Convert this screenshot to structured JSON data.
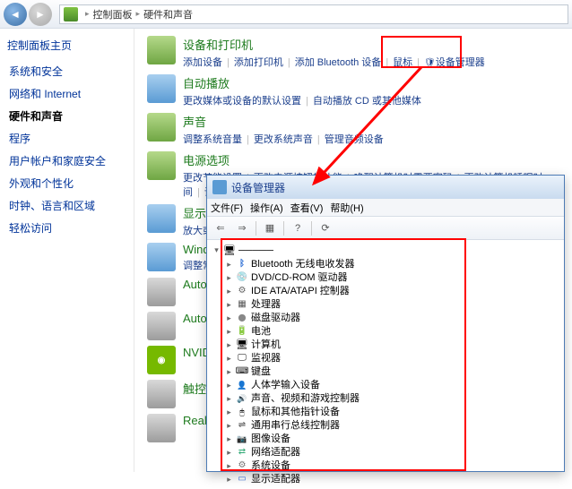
{
  "breadcrumb": {
    "part1": "控制面板",
    "part2": "硬件和声音"
  },
  "sidebar": {
    "title": "控制面板主页",
    "items": [
      "系统和安全",
      "网络和 Internet",
      "硬件和声音",
      "程序",
      "用户帐户和家庭安全",
      "外观和个性化",
      "时钟、语言和区域",
      "轻松访问"
    ]
  },
  "sections": [
    {
      "title": "设备和打印机",
      "links": [
        "添加设备",
        "添加打印机",
        "添加 Bluetooth 设备",
        "鼠标",
        "设备管理器"
      ],
      "shield_on": 4
    },
    {
      "title": "自动播放",
      "links": [
        "更改媒体或设备的默认设置",
        "自动播放 CD 或其他媒体"
      ]
    },
    {
      "title": "声音",
      "links": [
        "调整系统音量",
        "更改系统声音",
        "管理音频设备"
      ]
    },
    {
      "title": "电源选项",
      "links": [
        "更改节能设置",
        "更改电源按钮的功能",
        "唤醒计算机时需要密码",
        "更改计算机睡眠时间",
        "调整屏幕亮度"
      ]
    },
    {
      "title": "显示",
      "links": [
        "放大或缩..."
      ]
    },
    {
      "title": "Window",
      "sub": "调整常用"
    },
    {
      "title": "Autode"
    },
    {
      "title": "Autode"
    },
    {
      "title": "NVIDIA"
    },
    {
      "title": "触控板"
    },
    {
      "title": "Realtek"
    }
  ],
  "devmgr": {
    "title": "设备管理器",
    "menu": [
      "文件(F)",
      "操作(A)",
      "查看(V)",
      "帮助(H)"
    ],
    "root": "…",
    "items": [
      "Bluetooth 无线电收发器",
      "DVD/CD-ROM 驱动器",
      "IDE ATA/ATAPI 控制器",
      "处理器",
      "磁盘驱动器",
      "电池",
      "计算机",
      "监视器",
      "键盘",
      "人体学输入设备",
      "声音、视频和游戏控制器",
      "鼠标和其他指针设备",
      "通用串行总线控制器",
      "图像设备",
      "网络适配器",
      "系统设备",
      "显示适配器"
    ],
    "icons": [
      "ic-bt",
      "ic-cd",
      "ic-ide",
      "ic-cpu",
      "ic-disk",
      "ic-bat",
      "ic-pc",
      "ic-mon",
      "ic-kb",
      "ic-hid",
      "ic-snd",
      "ic-mouse",
      "ic-usb",
      "ic-img",
      "ic-net",
      "ic-sys",
      "ic-disp"
    ]
  }
}
